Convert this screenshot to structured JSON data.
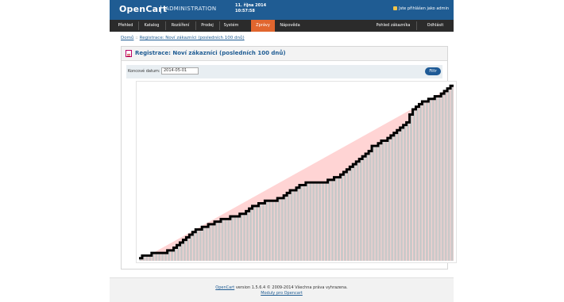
{
  "header": {
    "brand": "OpenCart",
    "subtitle": "ADMINISTRATION",
    "date": "11. října 2014",
    "time": "10:57:58",
    "login": "Jste přihlášen jako admin"
  },
  "menu": {
    "items": [
      "Přehled",
      "Katalog",
      "Rozšíření",
      "Prodej",
      "Systém",
      "Zprávy",
      "Nápověda"
    ],
    "active": "Zprávy",
    "right": [
      "Pohled zákazníka",
      "Odhlásit"
    ]
  },
  "breadcrumb": {
    "home": "Domů",
    "separator": "::",
    "current": "Registrace: Noví zákazníci (posledních 100 dnů)"
  },
  "panel": {
    "title": "Registrace: Noví zákazníci (posledních 100 dnů)"
  },
  "filter": {
    "label": "Koncové datum:",
    "value": "2014-05-01",
    "button": "Filtr"
  },
  "chart_data": {
    "type": "bar",
    "values": [
      1,
      2,
      2,
      2,
      3,
      3,
      3,
      3,
      3,
      4,
      4,
      5,
      6,
      7,
      8,
      9,
      10,
      11,
      12,
      12,
      13,
      13,
      14,
      14,
      15,
      15,
      16,
      16,
      16,
      17,
      17,
      17,
      18,
      18,
      19,
      20,
      21,
      21,
      22,
      22,
      23,
      23,
      23,
      23,
      24,
      24,
      25,
      26,
      27,
      27,
      28,
      29,
      29,
      30,
      30,
      30,
      30,
      30,
      30,
      30,
      31,
      31,
      32,
      32,
      33,
      34,
      35,
      36,
      37,
      38,
      39,
      40,
      41,
      42,
      44,
      44,
      45,
      46,
      46,
      47,
      48,
      49,
      50,
      51,
      52,
      53,
      56,
      58,
      59,
      60,
      61,
      61,
      62,
      62,
      63,
      63,
      64,
      65,
      66,
      67
    ],
    "ylim": [
      0,
      68
    ],
    "colors": {
      "bar": "#c9c9c9",
      "line": "#000000",
      "trend": "#ffd4d4"
    }
  },
  "footer": {
    "link": "OpenCart",
    "text": "version 1.5.6.4 © 2009-2014 Všechna práva vyhrazena.",
    "modules": "Moduly pro Opencart"
  }
}
